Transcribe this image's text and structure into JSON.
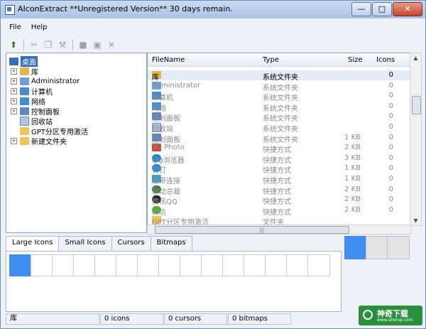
{
  "window": {
    "title": "AIconExtract  **Unregistered Version** 30 days remain.",
    "buttons": {
      "minimize": "—",
      "maximize": "□",
      "close": "✕"
    }
  },
  "menu": [
    "File",
    "Help"
  ],
  "toolbar_icons": [
    "up-folder-icon",
    "cut-icon",
    "copy-icon",
    "extract-icon",
    "stop-icon",
    "save-icon",
    "delete-icon"
  ],
  "tree": [
    {
      "label": "桌面",
      "icon": "desktop-icon",
      "expander": "",
      "selected": true
    },
    {
      "label": "库",
      "icon": "library-icon",
      "expander": "+"
    },
    {
      "label": "Administrator",
      "icon": "user-folder-icon",
      "expander": "+"
    },
    {
      "label": "计算机",
      "icon": "computer-icon",
      "expander": "+"
    },
    {
      "label": "网络",
      "icon": "network-icon",
      "expander": "+"
    },
    {
      "label": "控制面板",
      "icon": "control-panel-icon",
      "expander": "+"
    },
    {
      "label": "回收站",
      "icon": "recycle-bin-icon",
      "expander": ""
    },
    {
      "label": "GPT分区专用激活",
      "icon": "folder-icon",
      "expander": ""
    },
    {
      "label": "新建文件夹",
      "icon": "folder-icon",
      "expander": "+"
    }
  ],
  "file_table": {
    "headers": {
      "name": "FileName",
      "type": "Type",
      "size": "Size",
      "icons": "Icons"
    },
    "rows": [
      {
        "name": "库",
        "icon": "library-icon",
        "type": "系统文件夹",
        "size": "",
        "icons": "0",
        "selected": true
      },
      {
        "name": "Administrator",
        "icon": "user-folder-icon",
        "type": "系统文件夹",
        "size": "",
        "icons": "0"
      },
      {
        "name": "计算机",
        "icon": "computer-icon",
        "type": "系统文件夹",
        "size": "",
        "icons": "0"
      },
      {
        "name": "网络",
        "icon": "network-icon",
        "type": "系统文件夹",
        "size": "",
        "icons": "0"
      },
      {
        "name": "控制面板",
        "icon": "control-panel-icon",
        "type": "系统文件夹",
        "size": "",
        "icons": "0"
      },
      {
        "name": "回收站",
        "icon": "recycle-bin-icon",
        "type": "系统文件夹",
        "size": "",
        "icons": "0"
      },
      {
        "name": "控制面板",
        "icon": "control-panel-icon",
        "type": "系统文件夹",
        "size": "1 KB",
        "icons": "0"
      },
      {
        "name": "3D Photo",
        "icon": "3d-photo-icon",
        "type": "快捷方式",
        "size": "2 KB",
        "icons": "0"
      },
      {
        "name": "QQ浏览器",
        "icon": "browser-icon",
        "type": "快捷方式",
        "size": "3 KB",
        "icons": "0"
      },
      {
        "name": "钉钉",
        "icon": "dingtalk-icon",
        "type": "快捷方式",
        "size": "1 KB",
        "icons": "0"
      },
      {
        "name": "宽带连接",
        "icon": "broadband-icon",
        "type": "快捷方式",
        "size": "1 KB",
        "icons": "0"
      },
      {
        "name": "驱动总裁",
        "icon": "driver-icon",
        "type": "快捷方式",
        "size": "2 KB",
        "icons": "0"
      },
      {
        "name": "腾讯QQ",
        "icon": "qq-icon",
        "type": "快捷方式",
        "size": "2 KB",
        "icons": "0"
      },
      {
        "name": "微信",
        "icon": "wechat-icon",
        "type": "快捷方式",
        "size": "2 KB",
        "icons": "0"
      },
      {
        "name": "GPT分区专用激活",
        "icon": "folder-icon",
        "type": "文件夹",
        "size": "",
        "icons": ""
      }
    ]
  },
  "tabs": [
    "Large Icons",
    "Small Icons",
    "Cursors",
    "Bitmaps"
  ],
  "status": {
    "location": "库",
    "icons": "0 icons",
    "cursors": "0 cursors",
    "bitmaps": "0 bitmaps"
  },
  "watermark": {
    "text": "神奇下载",
    "sub": "www.shenqi.com"
  },
  "colors": {
    "selection": "#3d8ef0",
    "tree_selection": "#316ac5"
  }
}
